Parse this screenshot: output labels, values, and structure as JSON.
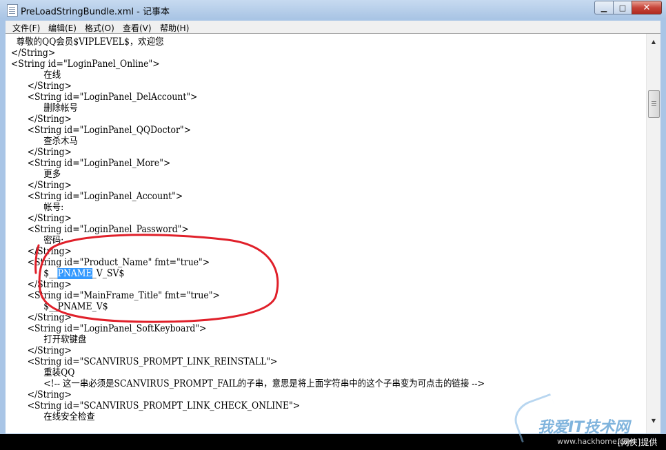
{
  "window": {
    "title": "PreLoadStringBundle.xml - 记事本",
    "controls": {
      "minimize": "0",
      "maximize": "1",
      "close": "x"
    }
  },
  "menu": [
    "文件(F)",
    "编辑(E)",
    "格式(O)",
    "查看(V)",
    "帮助(H)"
  ],
  "editor": {
    "lines": [
      "    尊敬的QQ会员$VIPLEVEL$，欢迎您",
      "  </String>",
      "  <String id=\"LoginPanel_Online\">",
      "              在线",
      "        </String>",
      "        <String id=\"LoginPanel_DelAccount\">",
      "              删除帐号",
      "        </String>",
      "        <String id=\"LoginPanel_QQDoctor\">",
      "              查杀木马",
      "        </String>",
      "        <String id=\"LoginPanel_More\">",
      "              更多",
      "        </String>",
      "        <String id=\"LoginPanel_Account\">",
      "              帐号:",
      "        </String>",
      "        <String id=\"LoginPanel_Password\">",
      "              密码:",
      "        </String>",
      "        <String id=\"Product_Name\" fmt=\"true\">",
      "",
      "        </String>",
      "        <String id=\"MainFrame_Title\" fmt=\"true\">",
      "              $__PNAME_V$",
      "        </String>",
      "        <String id=\"LoginPanel_SoftKeyboard\">",
      "              打开软键盘",
      "        </String>",
      "        <String id=\"SCANVIRUS_PROMPT_LINK_REINSTALL\">",
      "              重装QQ",
      "              <!-- 这一串必须是SCANVIRUS_PROMPT_FAIL的子串，意思是将上面字符串中的这个子串变为可点击的链接 -->",
      "        </String>",
      "        <String id=\"SCANVIRUS_PROMPT_LINK_CHECK_ONLINE\">",
      "              在线安全检查"
    ],
    "selected_line": {
      "before": "              $__",
      "selected": "PNAME",
      "after": "_V_SV$"
    }
  },
  "watermark": {
    "logo": "我爱IT技术网",
    "url": "www.hackhome.com",
    "suffix": "[网侠]提供"
  },
  "colors": {
    "selection": "#3399ff",
    "annotation": "#e0202a"
  }
}
